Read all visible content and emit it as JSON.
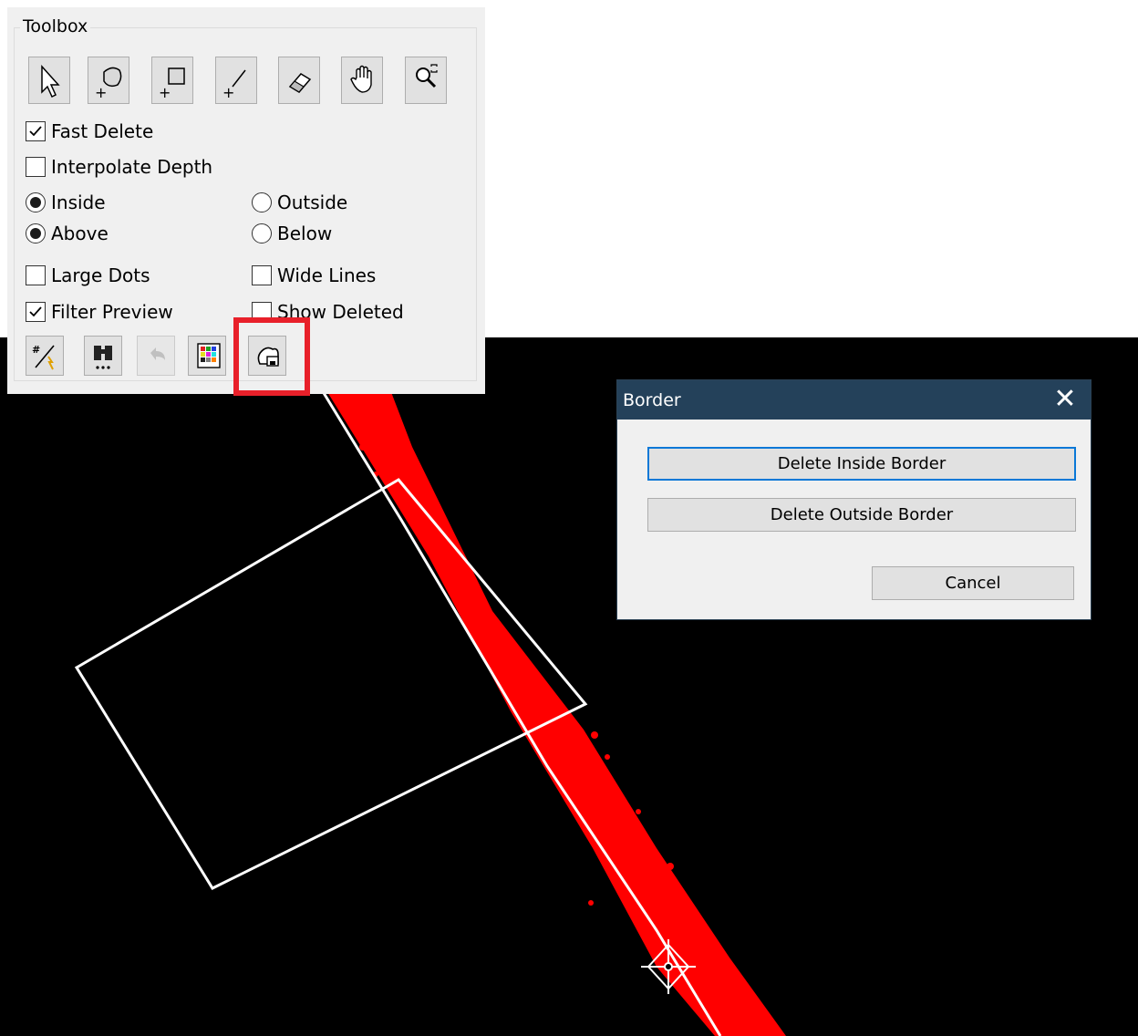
{
  "toolbox": {
    "title": "Toolbox",
    "tools": [
      {
        "name": "select-arrow-icon"
      },
      {
        "name": "add-lasso-icon"
      },
      {
        "name": "add-rectangle-icon"
      },
      {
        "name": "add-line-icon"
      },
      {
        "name": "eraser-icon"
      },
      {
        "name": "pan-hand-icon"
      },
      {
        "name": "zoom-extent-icon"
      }
    ],
    "options": {
      "fast_delete": {
        "label": "Fast Delete",
        "checked": true
      },
      "interpolate_depth": {
        "label": "Interpolate Depth",
        "checked": false
      },
      "inside": {
        "label": "Inside",
        "selected": true
      },
      "outside": {
        "label": "Outside",
        "selected": false
      },
      "above": {
        "label": "Above",
        "selected": true
      },
      "below": {
        "label": "Below",
        "selected": false
      },
      "large_dots": {
        "label": "Large Dots",
        "checked": false
      },
      "wide_lines": {
        "label": "Wide Lines",
        "checked": false
      },
      "filter_preview": {
        "label": "Filter Preview",
        "checked": true
      },
      "show_deleted": {
        "label": "Show Deleted",
        "checked": false
      }
    },
    "bottom_tools": [
      {
        "name": "filter-run-icon",
        "enabled": true
      },
      {
        "name": "binoculars-icon",
        "enabled": true
      },
      {
        "name": "undo-icon",
        "enabled": false
      },
      {
        "name": "color-palette-icon",
        "enabled": true
      },
      {
        "name": "border-delete-icon",
        "enabled": true,
        "highlighted": true
      }
    ]
  },
  "border_dialog": {
    "title": "Border",
    "close_label": "✕",
    "delete_inside_label": "Delete Inside Border",
    "delete_outside_label": "Delete Outside Border",
    "cancel_label": "Cancel"
  },
  "colors": {
    "canvas_background": "#000000",
    "point_cloud": "#ff0000",
    "border_line": "#ffffff",
    "highlight": "#e8202a",
    "dialog_titlebar": "#24415a",
    "focus_border": "#0a78d7"
  }
}
